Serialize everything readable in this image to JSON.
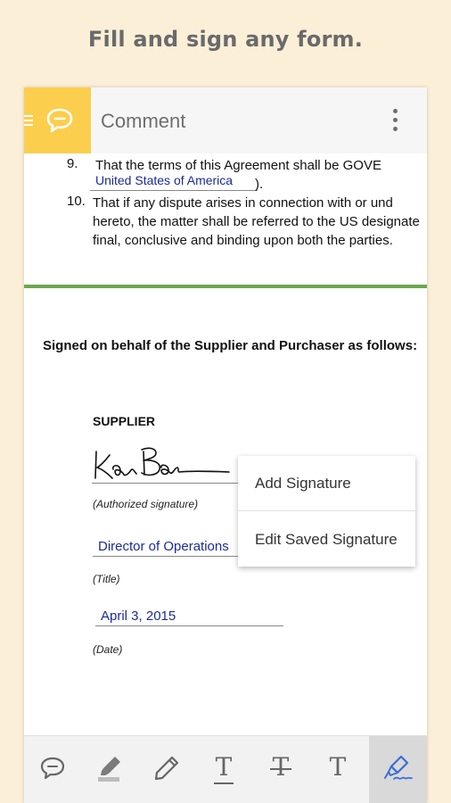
{
  "headline": "Fill and sign any form.",
  "app_bar": {
    "title": "Comment",
    "mode_icon": "comment-bubble-icon",
    "menu_icon": "overflow-menu-icon"
  },
  "document": {
    "clause9": {
      "number": "9.",
      "line1": "That the terms of this Agreement shall be GOVE",
      "field": "United States of America",
      "after_field": ")."
    },
    "clause10": {
      "number": "10.",
      "line1": "That if any dispute arises in connection with or und",
      "line2": "hereto, the matter shall be referred to the US designate",
      "line3": "final, conclusive and binding upon both the parties."
    },
    "signed_heading": "Signed on behalf of the Supplier and Purchaser as follows:",
    "supplier_label": "SUPPLIER",
    "authorized_caption": "(Authorized signature)",
    "title_value": "Director of Operations",
    "title_caption": "(Title)",
    "date_value": "April 3, 2015",
    "date_caption": "(Date)"
  },
  "popup_menu": {
    "items": [
      "Add Signature",
      "Edit Saved Signature"
    ]
  },
  "toolbar": {
    "tools": [
      "comment-icon",
      "highlighter-icon",
      "pencil-icon",
      "underline-text-icon",
      "strikethrough-text-icon",
      "add-text-icon",
      "signature-pen-icon"
    ],
    "underline_glyph": "T",
    "strike_glyph": "T",
    "text_glyph": "T",
    "active_tool": "signature-pen-icon"
  },
  "colors": {
    "background": "#fcefd8",
    "mode_tile": "#fcce4d",
    "divider_green": "#6aa84f",
    "field_text": "#1a2a9c",
    "active_tool": "#3b6fd6"
  }
}
